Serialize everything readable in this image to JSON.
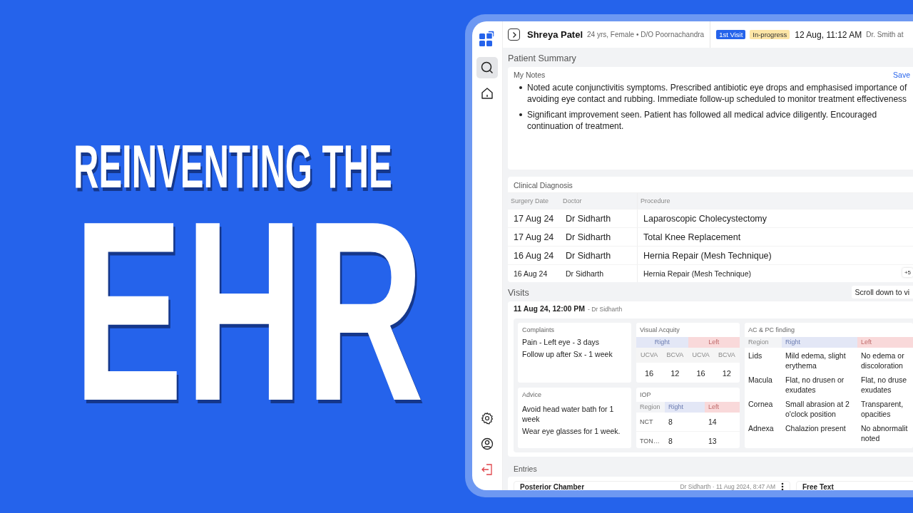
{
  "headline": {
    "line_1": "REINVENTING THE",
    "line_2": "EHR"
  },
  "sidebar": {
    "items": [
      {
        "kind": "search",
        "selected": true
      },
      {
        "kind": "home",
        "selected": false
      }
    ],
    "bottom_items": [
      {
        "kind": "settings",
        "selected": false
      },
      {
        "kind": "profile",
        "selected": false
      },
      {
        "kind": "logout",
        "selected": false
      }
    ]
  },
  "header": {
    "patient_name": "Shreya Patel",
    "patient_info": "24 yrs, Female • D/O Poornachandra",
    "badges": [
      {
        "label": "1st Visit",
        "kind": "visit"
      },
      {
        "label": "In-progress",
        "kind": "status"
      }
    ],
    "datetime": "12 Aug, 11:12 AM",
    "doctor": "Dr. Smith at"
  },
  "patient_summary": {
    "title": "Patient Summary",
    "notes": {
      "title": "My Notes",
      "action": "Save",
      "items": [
        "Noted acute conjunctivitis symptoms. Prescribed antibiotic eye drops and emphasised importance of avoiding eye contact and rubbing. Immediate follow-up scheduled to monitor treatment effectiveness",
        "Significant improvement seen. Patient has followed all medical advice diligently. Encouraged continuation of treatment."
      ]
    }
  },
  "clinical_diagnosis": {
    "title": "Clinical Diagnosis",
    "columns": [
      "Surgery Date",
      "Doctor",
      "Procedure"
    ],
    "rows": [
      {
        "cells": [
          "17 Aug 24",
          "Dr Sidharth",
          "Laparoscopic Cholecystectomy"
        ],
        "compact": false
      },
      {
        "cells": [
          "17 Aug 24",
          "Dr Sidharth",
          "Total Knee Replacement"
        ],
        "compact": false
      },
      {
        "cells": [
          "16 Aug 24",
          "Dr Sidharth",
          "Hernia Repair (Mesh Technique)"
        ],
        "compact": false
      },
      {
        "cells": [
          "16 Aug 24",
          "Dr Sidharth",
          "Hernia Repair (Mesh Technique)"
        ],
        "compact": true
      }
    ],
    "more": "+5"
  },
  "visits": {
    "title": "Visits",
    "scroll_hint": "Scroll down to vi",
    "visit": {
      "datetime": "11 Aug 24, 12:00 PM",
      "doctor": "- Dr Sidharth",
      "complaints": {
        "title": "Complaints",
        "items": [
          "Pain - Left eye - 3 days",
          "Follow up after Sx - 1 week"
        ]
      },
      "advice": {
        "title": "Advice",
        "items": [
          "Avoid head water bath for 1 week",
          "Wear eye glasses for 1 week."
        ]
      },
      "visual_acuity": {
        "title": "Visual Acquity",
        "eyes": [
          {
            "label": "Right",
            "color": "#e3e7f6"
          },
          {
            "label": "Left",
            "color": "#f9d9da"
          }
        ],
        "columns": [
          "UCVA",
          "BCVA",
          "UCVA",
          "BCVA"
        ],
        "values": [
          "16",
          "12",
          "16",
          "12"
        ]
      },
      "iop": {
        "title": "IOP",
        "columns": [
          {
            "label": "Region",
            "color": "#f3f4f6"
          },
          {
            "label": "Right",
            "color": "#e3e7f6"
          },
          {
            "label": "Left",
            "color": "#f9d9da"
          }
        ],
        "rows": [
          [
            "NCT",
            "8",
            "14"
          ],
          [
            "TON…",
            "8",
            "13"
          ]
        ]
      },
      "ac_pc": {
        "title": "AC & PC finding",
        "columns": [
          {
            "label": "Region",
            "color": "#f3f4f6"
          },
          {
            "label": "Right",
            "color": "#e3e7f6"
          },
          {
            "label": "Left",
            "color": "#f9d9da"
          }
        ],
        "rows": [
          [
            "Lids",
            "Mild edema, slight erythema",
            "No edema or\ndiscoloration"
          ],
          [
            "Macula",
            "Flat, no drusen or exudates",
            "Flat, no druse\nexudates"
          ],
          [
            "Cornea",
            "Small abrasion at 2 o'clock position",
            "Transparent,\nopacities"
          ],
          [
            "Adnexa",
            "Chalazion present",
            "No abnormalit\nnoted"
          ]
        ]
      }
    }
  },
  "entries": {
    "title": "Entries",
    "cards": [
      {
        "title": "Posterior Chamber",
        "meta": "Dr Sidharth · 11 Aug 2024, 8:47 AM",
        "has_menu": true
      },
      {
        "title": "Free Text",
        "has_menu": false
      }
    ]
  }
}
